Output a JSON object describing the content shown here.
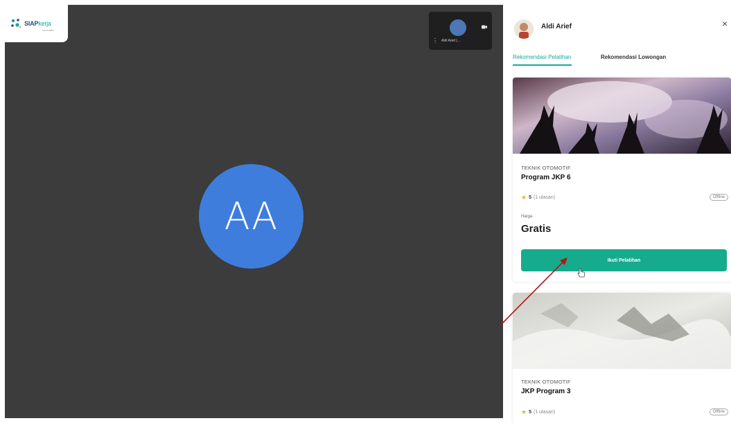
{
  "app": {
    "logo_text_main": "SIAP",
    "logo_text_accent": "kerja",
    "logo_subtext": "kemnaker"
  },
  "meeting": {
    "main_participant_initials": "AA",
    "self_view_name": "Aldi Arief (...",
    "self_view_menu_icon": "more-vert-icon",
    "self_view_camera_icon": "camera-icon"
  },
  "panel": {
    "user_name": "Aldi Arief",
    "close_symbol": "×",
    "tabs": [
      {
        "label": "Rekomendasi Pelatihan",
        "active": true
      },
      {
        "label": "Rekomendasi Lowongan",
        "active": false
      }
    ],
    "cards": [
      {
        "category": "TEKNIK OTOMOTIF",
        "title": "Program JKP 6",
        "rating_score": "5",
        "rating_count": "(1 ulasan)",
        "mode_badge": "Offline",
        "price_label": "Harga",
        "price": "Gratis",
        "cta_label": "Ikuti Pelatihan"
      },
      {
        "category": "TEKNIK OTOMOTIF",
        "title": "JKP Program 3",
        "rating_score": "5",
        "rating_count": "(1 ulasan)",
        "mode_badge": "Offline"
      }
    ]
  },
  "colors": {
    "stage_bg": "#3c3c3c",
    "avatar_blue": "#3f7ddc",
    "accent_teal": "#17ab8e",
    "annotation_arrow": "#b01515",
    "star": "#f2b01e"
  }
}
